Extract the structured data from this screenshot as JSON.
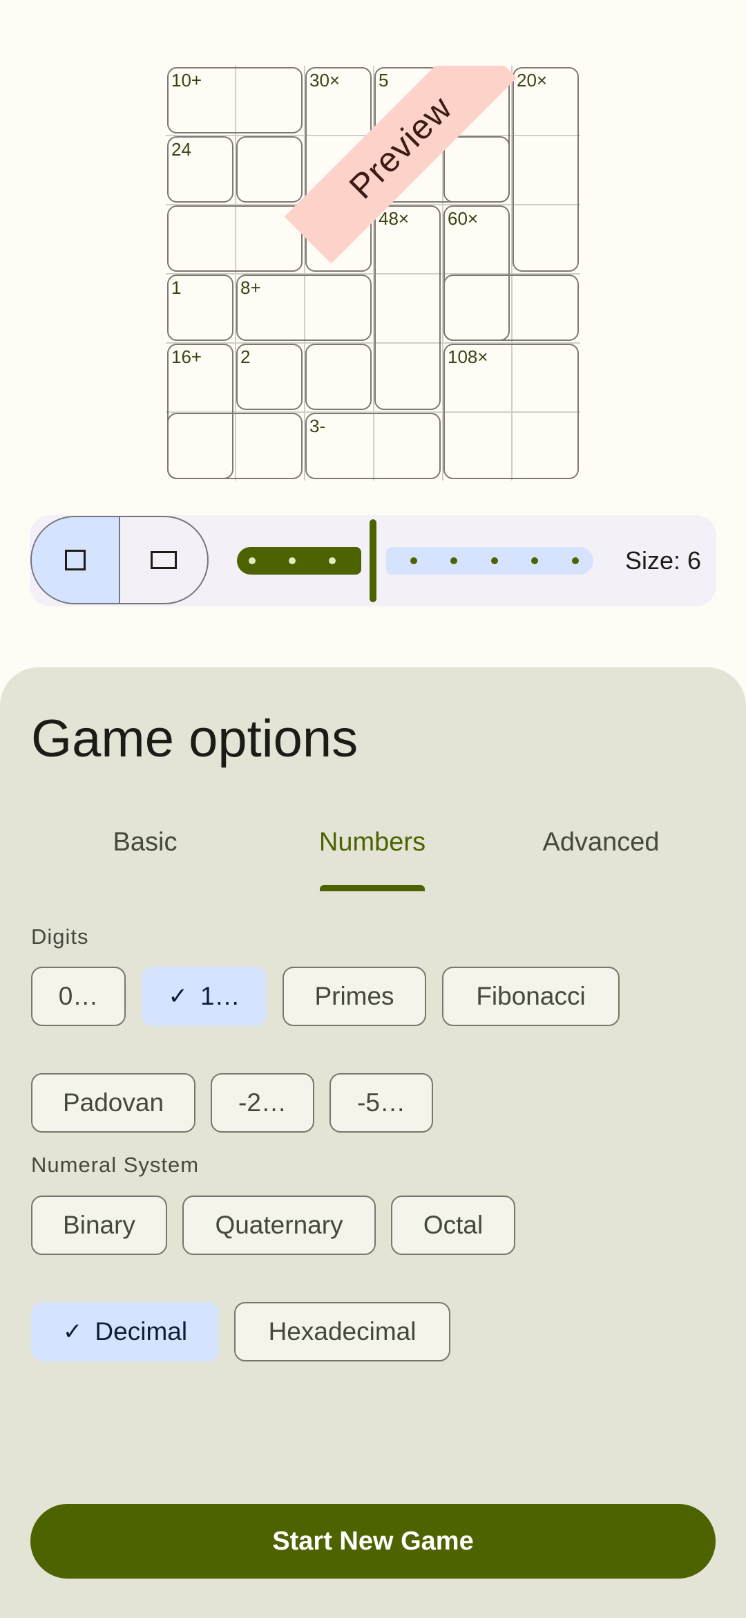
{
  "preview": {
    "ribbon_text": "Preview",
    "clues": [
      "10+",
      "30×",
      "5",
      "8+",
      "20×",
      "24",
      "48×",
      "60×",
      "1",
      "8+",
      "16+",
      "2",
      "108×",
      "3-"
    ]
  },
  "size_selector": {
    "shapes": [
      "square",
      "rectangle"
    ],
    "selected_shape": "square",
    "label": "Size: 6",
    "value": 6
  },
  "options": {
    "title": "Game options",
    "tabs": [
      "Basic",
      "Numbers",
      "Advanced"
    ],
    "active_tab": "Numbers",
    "digits": {
      "label": "Digits",
      "chips": [
        "0…",
        "1…",
        "Primes",
        "Fibonacci",
        "Padovan",
        "-2…",
        "-5…"
      ],
      "selected": "1…"
    },
    "numeral_system": {
      "label": "Numeral System",
      "chips": [
        "Binary",
        "Quaternary",
        "Octal",
        "Decimal",
        "Hexadecimal"
      ],
      "selected": "Decimal"
    },
    "start_button": "Start New Game"
  },
  "colors": {
    "primary": "#4d6300",
    "selected_chip": "#d5e3fe",
    "sheet": "#e3e4d6",
    "ribbon": "#fdd3c9"
  }
}
